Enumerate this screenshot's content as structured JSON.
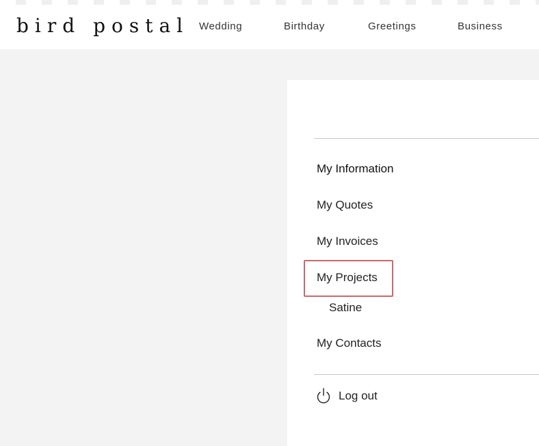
{
  "header": {
    "logo": "bird postal",
    "nav": [
      "Wedding",
      "Birthday",
      "Greetings",
      "Business"
    ]
  },
  "account_menu": {
    "items": {
      "information": "My Information",
      "quotes": "My Quotes",
      "invoices": "My Invoices",
      "projects": "My Projects",
      "project_sub": "Satine",
      "contacts": "My Contacts"
    },
    "logout_label": "Log out",
    "logout_icon": "power-icon"
  },
  "colors": {
    "highlight": "#c9686b",
    "page_bg": "#f3f3f3"
  }
}
